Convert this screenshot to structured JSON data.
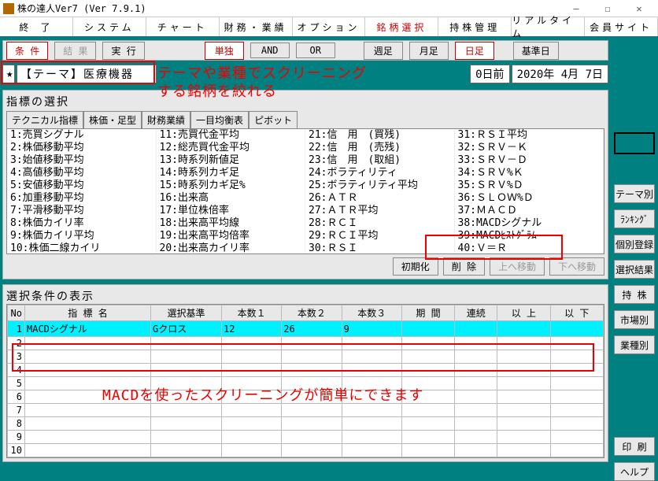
{
  "window": {
    "title": "株の達人Ver7 (Ver 7.9.1)"
  },
  "menubar": [
    "終 了",
    "システム",
    "チャート",
    "財務・業績",
    "オプション",
    "銘柄選択",
    "持株管理",
    "リアルタイム",
    "会員サイト"
  ],
  "menubar_selected_index": 5,
  "toolbar1": {
    "condition": "条 件",
    "result": "結 果",
    "run": "実  行",
    "single": "単独",
    "and": "AND",
    "or": "OR",
    "week": "週足",
    "month": "月足",
    "day": "日足",
    "basedate": "基準日"
  },
  "theme": {
    "star": "★",
    "label": "【テーマ】医療機器",
    "days_ago": "0日前",
    "date": "2020年 4月 7日"
  },
  "indicator_panel": {
    "title": "指標の選択",
    "tabs": [
      "テクニカル指標",
      "株価・足型",
      "財務業績",
      "一目均衡表",
      "ピボット"
    ],
    "cols": [
      [
        "1:売買シグナル",
        "2:株価移動平均",
        "3:始値移動平均",
        "4:高値移動平均",
        "5:安値移動平均",
        "6:加重移動平均",
        "7:平滑移動平均",
        "8:株価カイリ率",
        "9:株価カイリ平均",
        "10:株価二線カイリ"
      ],
      [
        "11:売買代金平均",
        "12:総売買代金平均",
        "13:時系列新値足",
        "14:時系列カギ足",
        "15:時系列カギ足%",
        "16:出来高",
        "17:単位株倍率",
        "18:出来高平均線",
        "19:出来高平均倍率",
        "20:出来高カイリ率"
      ],
      [
        "21:信　用　(買残)",
        "22:信　用　(売残)",
        "23:信　用　(取組)",
        "24:ボラティリティ",
        "25:ボラティリティ平均",
        "26:ＡＴＲ",
        "27:ＡＴＲ平均",
        "28:ＲＣＩ",
        "29:ＲＣＩ平均",
        "30:ＲＳＩ"
      ],
      [
        "31:ＲＳＩ平均",
        "32:ＳＲＶ－Ｋ",
        "33:ＳＲＶ－Ｄ",
        "34:ＳＲＶ%Ｋ",
        "35:ＳＲＶ%Ｄ",
        "36:ＳＬＯＷ%Ｄ",
        "37:ＭＡＣＤ",
        "38:MACDシグナル",
        "39:MACDﾋｽﾄｸﾞﾗﾑ",
        "40:Ｖ＝Ｒ"
      ]
    ],
    "btns": {
      "init": "初期化",
      "del": "削  除",
      "up": "上へ移動",
      "down": "下へ移動"
    }
  },
  "cond_panel": {
    "title": "選択条件の表示",
    "headers": [
      "No",
      "指 標 名",
      "選択基準",
      "本数１",
      "本数２",
      "本数３",
      "期 間",
      "連続",
      "以  上",
      "以  下"
    ],
    "rows": [
      {
        "no": "1",
        "name": "MACDシグナル",
        "basis": "Gクロス",
        "n1": "12",
        "n2": "26",
        "n3": "9",
        "period": "",
        "cont": "",
        "gte": "",
        "lte": ""
      },
      {
        "no": "2"
      },
      {
        "no": "3"
      },
      {
        "no": "4"
      },
      {
        "no": "5"
      },
      {
        "no": "6"
      },
      {
        "no": "7"
      },
      {
        "no": "8"
      },
      {
        "no": "9"
      },
      {
        "no": "10"
      }
    ]
  },
  "sidebar": [
    "テーマ別",
    "ﾗﾝｷﾝｸﾞ",
    "個別登録",
    "選択結果",
    "持  株",
    "市場別",
    "業種別"
  ],
  "sidebar_bottom": [
    "印  刷",
    "ヘルプ"
  ],
  "annotations": {
    "a1_l1": "テーマや業種でスクリーニング",
    "a1_l2": "する銘柄を絞れる",
    "a2": "MACDを使ったスクリーニングが簡単にできます"
  }
}
